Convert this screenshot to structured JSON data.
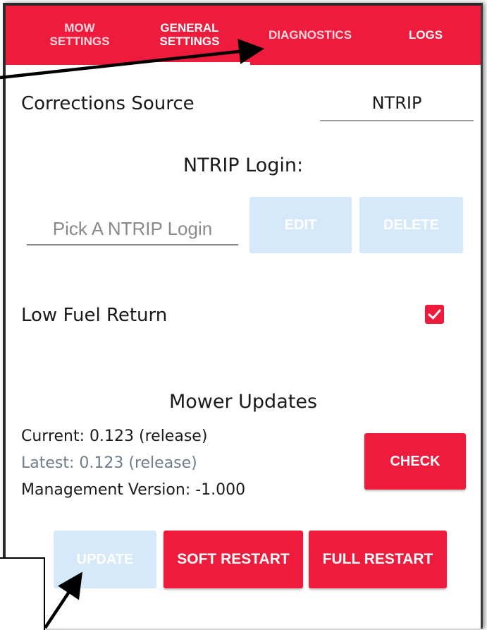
{
  "tabs": {
    "mow": [
      "MOW",
      "SETTINGS"
    ],
    "general": [
      "GENERAL",
      "SETTINGS"
    ],
    "diagnostics": "DIAGNOSTICS",
    "logs": "LOGS"
  },
  "corrections": {
    "label": "Corrections Source",
    "value": "NTRIP"
  },
  "ntrip": {
    "title": "NTRIP Login:",
    "placeholder": "Pick A NTRIP Login",
    "edit_label": "EDIT",
    "delete_label": "DELETE"
  },
  "low_fuel": {
    "label": "Low Fuel Return",
    "checked": true
  },
  "updates": {
    "title": "Mower Updates",
    "current": "Current: 0.123 (release)",
    "latest": "Latest: 0.123 (release)",
    "management": "Management Version: -1.000",
    "check_label": "CHECK",
    "update_label": "UPDATE",
    "soft_restart_label": "SOFT RESTART",
    "full_restart_label": "FULL RESTART"
  },
  "colors": {
    "accent": "#ee1b3c",
    "disabled_button": "#d6e9fa",
    "latest_text": "#6f7d8a"
  },
  "icons": {
    "checkbox": "checkmark-icon"
  }
}
